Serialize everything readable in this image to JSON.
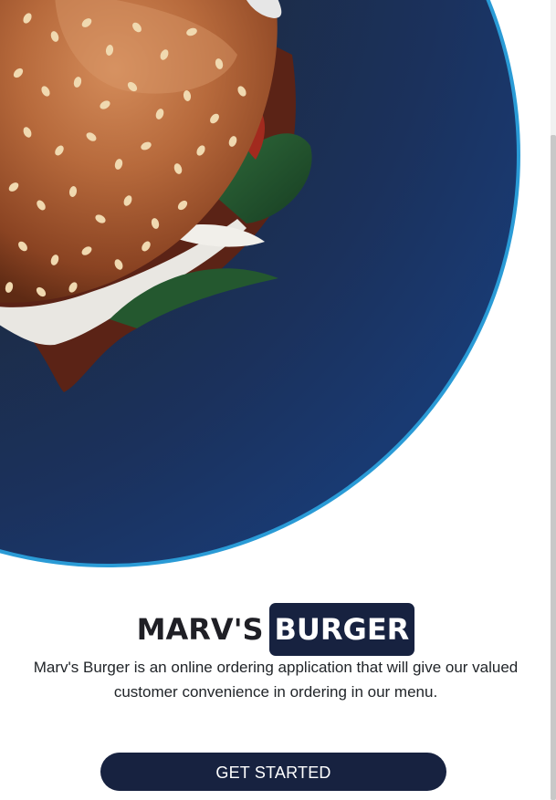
{
  "hero": {
    "image": "burger-on-blue-plate"
  },
  "brand": {
    "name_part1": "MARV'S",
    "name_part2": "BURGER"
  },
  "description": "Marv's Burger is an online ordering application that will give our valued customer convenience in ordering in our menu.",
  "cta": {
    "label": "GET STARTED"
  },
  "colors": {
    "accent": "#172240",
    "text": "#1f1f25",
    "plate": "#1b2f57"
  }
}
